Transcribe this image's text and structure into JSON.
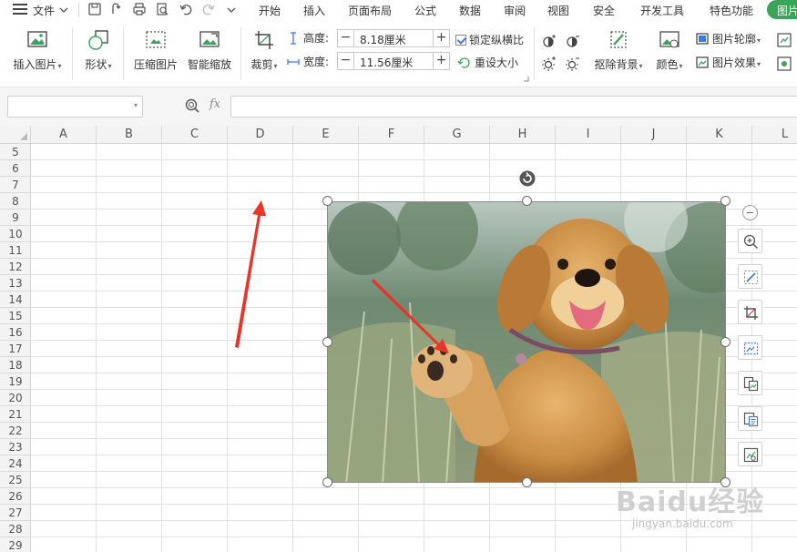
{
  "menu": {
    "file_label": "文件",
    "tabs": [
      "开始",
      "插入",
      "页面布局",
      "公式",
      "数据",
      "审阅",
      "视图",
      "安全",
      "开发工具",
      "特色功能"
    ],
    "active_tab": "图片"
  },
  "ribbon": {
    "insert_picture": "插入图片",
    "shape": "形状",
    "compress_picture": "压缩图片",
    "smart_scale": "智能缩放",
    "crop": "裁剪",
    "height_label": "高度:",
    "height_value": "8.18厘米",
    "width_label": "宽度:",
    "width_value": "11.56厘米",
    "lock_ratio": "锁定纵横比",
    "reset_size": "重设大小",
    "remove_bg": "抠除背景",
    "color": "颜色",
    "picture_outline": "图片轮廓",
    "picture_effect": "图片效果"
  },
  "formula_bar": {
    "name_box": "",
    "fx_symbol": "fx",
    "formula": ""
  },
  "grid": {
    "columns": [
      "A",
      "B",
      "C",
      "D",
      "E",
      "F",
      "G",
      "H",
      "I",
      "J",
      "K",
      "L"
    ],
    "rows": [
      "5",
      "6",
      "7",
      "8",
      "9",
      "10",
      "11",
      "12",
      "13",
      "14",
      "15",
      "16",
      "17",
      "18",
      "19",
      "20",
      "21",
      "22",
      "23",
      "24",
      "25",
      "26",
      "27",
      "28",
      "29"
    ]
  },
  "annotation_color": "#e8352b",
  "accent_color": "#3aa55a",
  "watermark": {
    "text": "Baidu经验",
    "sub": "jingyan.baidu.com"
  }
}
